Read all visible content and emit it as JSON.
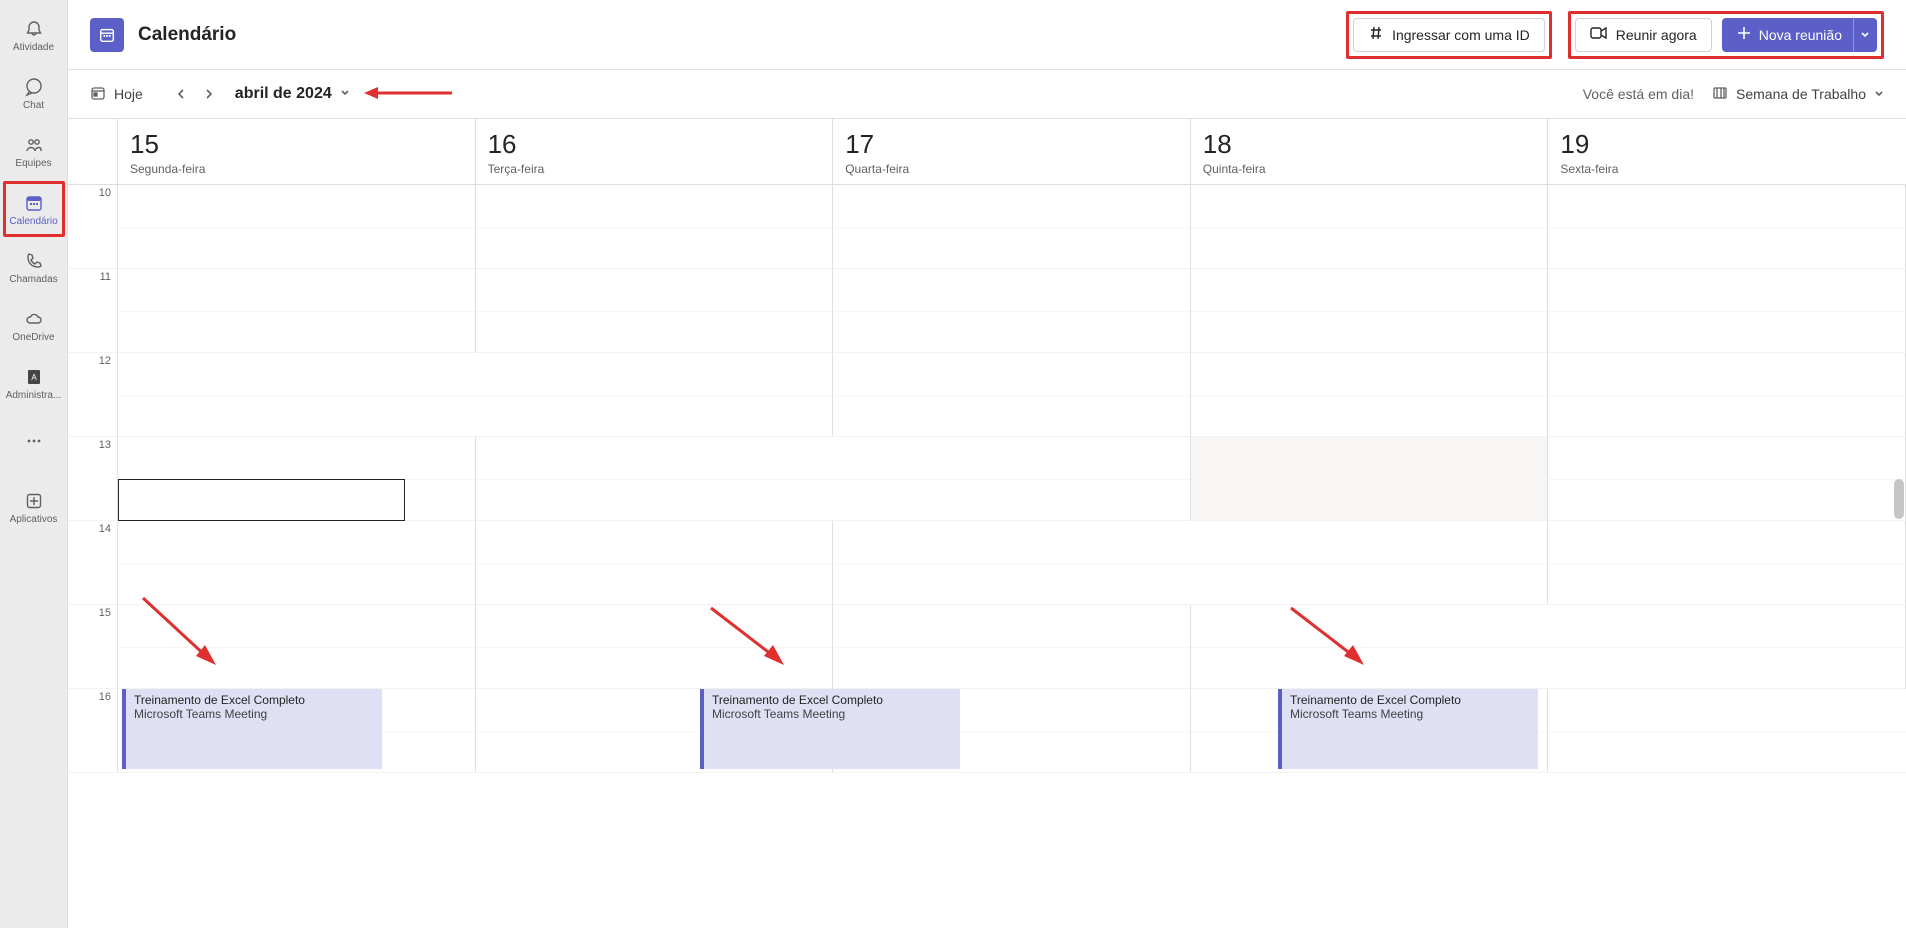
{
  "rail": {
    "items": [
      {
        "label": "Atividade"
      },
      {
        "label": "Chat"
      },
      {
        "label": "Equipes"
      },
      {
        "label": "Calendário"
      },
      {
        "label": "Chamadas"
      },
      {
        "label": "OneDrive"
      },
      {
        "label": "Administra..."
      }
    ],
    "apps_label": "Aplicativos"
  },
  "header": {
    "title": "Calendário",
    "join_id": "Ingressar com uma ID",
    "meet_now": "Reunir agora",
    "new_meeting": "Nova reunião"
  },
  "toolbar": {
    "today": "Hoje",
    "month": "abril de 2024",
    "status": "Você está em dia!",
    "view": "Semana de Trabalho"
  },
  "days": [
    {
      "num": "15",
      "dow": "Segunda-feira"
    },
    {
      "num": "16",
      "dow": "Terça-feira"
    },
    {
      "num": "17",
      "dow": "Quarta-feira"
    },
    {
      "num": "18",
      "dow": "Quinta-feira"
    },
    {
      "num": "19",
      "dow": "Sexta-feira"
    }
  ],
  "hours": [
    "10",
    "11",
    "12",
    "13",
    "14",
    "15",
    "16"
  ],
  "events": [
    {
      "title": "Treinamento de Excel Completo",
      "sub": "Microsoft Teams Meeting"
    },
    {
      "title": "Treinamento de Excel Completo",
      "sub": "Microsoft Teams Meeting"
    },
    {
      "title": "Treinamento de Excel Completo",
      "sub": "Microsoft Teams Meeting"
    }
  ]
}
